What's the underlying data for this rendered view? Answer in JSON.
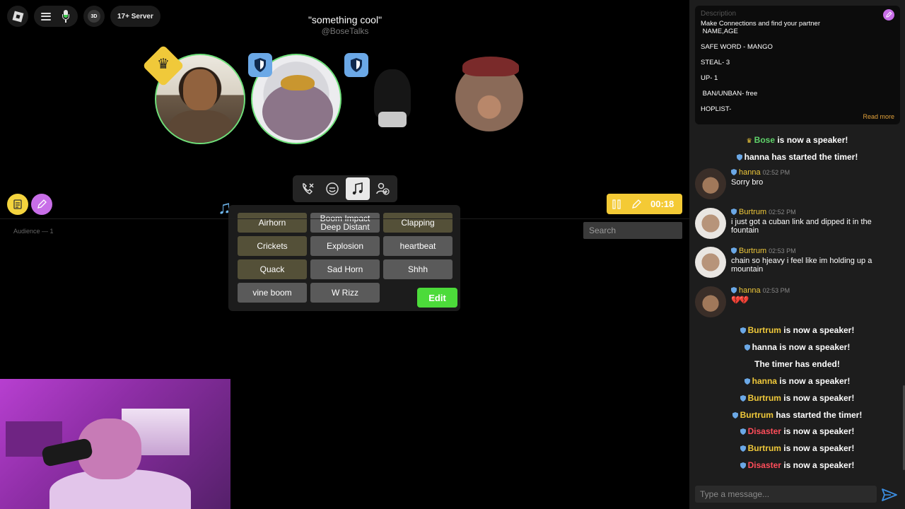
{
  "topbar": {
    "badge_3d": "3D",
    "server_label": "17+ Server"
  },
  "stage": {
    "title": "\"something cool\"",
    "host": "@BoseTalks"
  },
  "soundboard": {
    "sounds": [
      "Airhorn",
      "Boom Impact Deep Distant",
      "Clapping",
      "Crickets",
      "Explosion",
      "heartbeat",
      "Quack",
      "Sad Horn",
      "Shhh",
      "vine boom",
      "W Rizz"
    ],
    "edit_label": "Edit"
  },
  "timer": {
    "value": "00:18"
  },
  "audience": {
    "label": "Audience — 1"
  },
  "search": {
    "placeholder": "Search"
  },
  "description": {
    "label": "Description",
    "lines": [
      "Make Connections and find your partner",
      " NAME,AGE",
      "",
      "SAFE WORD - MANGO",
      "",
      "STEAL- 3",
      "",
      "UP- 1",
      "",
      " BAN/UNBAN- free",
      "",
      "HOPLIST-"
    ],
    "read_more": "Read more"
  },
  "chat": {
    "system_top": [
      {
        "name": "Bose",
        "text": " is now a speaker!",
        "color": "green",
        "role": "crown"
      },
      {
        "name": "hanna",
        "text": " has started the timer!",
        "color": "white",
        "role": "shield"
      }
    ],
    "messages": [
      {
        "name": "hanna",
        "time": "02:52 PM",
        "text": "Sorry bro",
        "avatar": "a"
      },
      {
        "name": "Burtrum",
        "time": "02:52 PM",
        "text": "i just got a cuban link and dipped it in the fountain",
        "avatar": "b"
      },
      {
        "name": "Burtrum",
        "time": "02:53 PM",
        "text": "chain so hjeavy i feel like im holding up a mountain",
        "avatar": "b"
      },
      {
        "name": "hanna",
        "time": "02:53 PM",
        "text": "💔💔",
        "avatar": "a"
      }
    ],
    "system_bottom": [
      {
        "name": "Burtrum",
        "text": " is now a speaker!",
        "color": "yellow"
      },
      {
        "name": "hanna",
        "text": " is now a speaker!",
        "color": "white"
      },
      {
        "name": "",
        "text": "The timer has ended!",
        "color": "white"
      },
      {
        "name": "hanna",
        "text": " is now a speaker!",
        "color": "yellow"
      },
      {
        "name": "Burtrum",
        "text": " is now a speaker!",
        "color": "yellow"
      },
      {
        "name": "Burtrum",
        "text": " has started the timer!",
        "color": "yellow"
      },
      {
        "name": "Disaster",
        "text": " is now a speaker!",
        "color": "red"
      },
      {
        "name": "Burtrum",
        "text": " is now a speaker!",
        "color": "yellow"
      },
      {
        "name": "Disaster",
        "text": " is now a speaker!",
        "color": "red"
      }
    ],
    "input_placeholder": "Type a message..."
  },
  "colors": {
    "accent_green": "#4cdb3a",
    "timer_yellow": "#f4ca35",
    "moderator_blue": "#6ba8e6",
    "name_yellow": "#f0c93a",
    "name_red": "#ff4d5a"
  }
}
